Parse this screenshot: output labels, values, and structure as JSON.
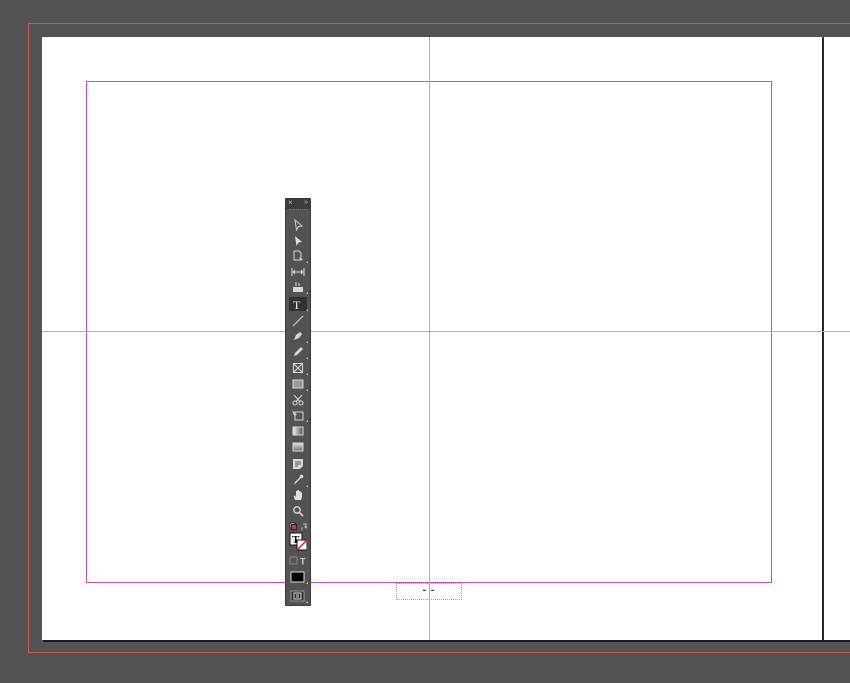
{
  "document": {
    "page_number_marker": "- -"
  },
  "colors": {
    "pasteboard": "#535353",
    "page": "#ffffff",
    "bleed": "#d0584a",
    "margin": "#c44bd6",
    "guide": "#3fe0df"
  },
  "tools_panel": {
    "close_glyph": "×",
    "collapse_glyph": "»",
    "tools": [
      {
        "name": "selection-tool",
        "icon": "arrow-outline-icon"
      },
      {
        "name": "direct-selection-tool",
        "icon": "arrow-filled-icon"
      },
      {
        "name": "page-tool",
        "icon": "page-icon"
      },
      {
        "name": "gap-tool",
        "icon": "gap-icon"
      },
      {
        "name": "content-collector-tool",
        "icon": "content-collector-icon"
      },
      {
        "name": "type-tool",
        "icon": "type-icon",
        "active": true
      },
      {
        "name": "line-tool",
        "icon": "line-icon"
      },
      {
        "name": "pen-tool",
        "icon": "pen-icon"
      },
      {
        "name": "pencil-tool",
        "icon": "pencil-icon"
      },
      {
        "name": "rectangle-frame-tool",
        "icon": "rectangle-frame-icon"
      },
      {
        "name": "rectangle-tool",
        "icon": "rectangle-icon"
      },
      {
        "name": "scissors-tool",
        "icon": "scissors-icon"
      },
      {
        "name": "free-transform-tool",
        "icon": "free-transform-icon"
      },
      {
        "name": "gradient-swatch-tool",
        "icon": "gradient-swatch-icon"
      },
      {
        "name": "gradient-feather-tool",
        "icon": "gradient-feather-icon"
      },
      {
        "name": "note-tool",
        "icon": "note-icon"
      },
      {
        "name": "eyedropper-tool",
        "icon": "eyedropper-icon"
      },
      {
        "name": "hand-tool",
        "icon": "hand-icon"
      },
      {
        "name": "zoom-tool",
        "icon": "zoom-icon"
      }
    ],
    "type_glyph": "T"
  }
}
